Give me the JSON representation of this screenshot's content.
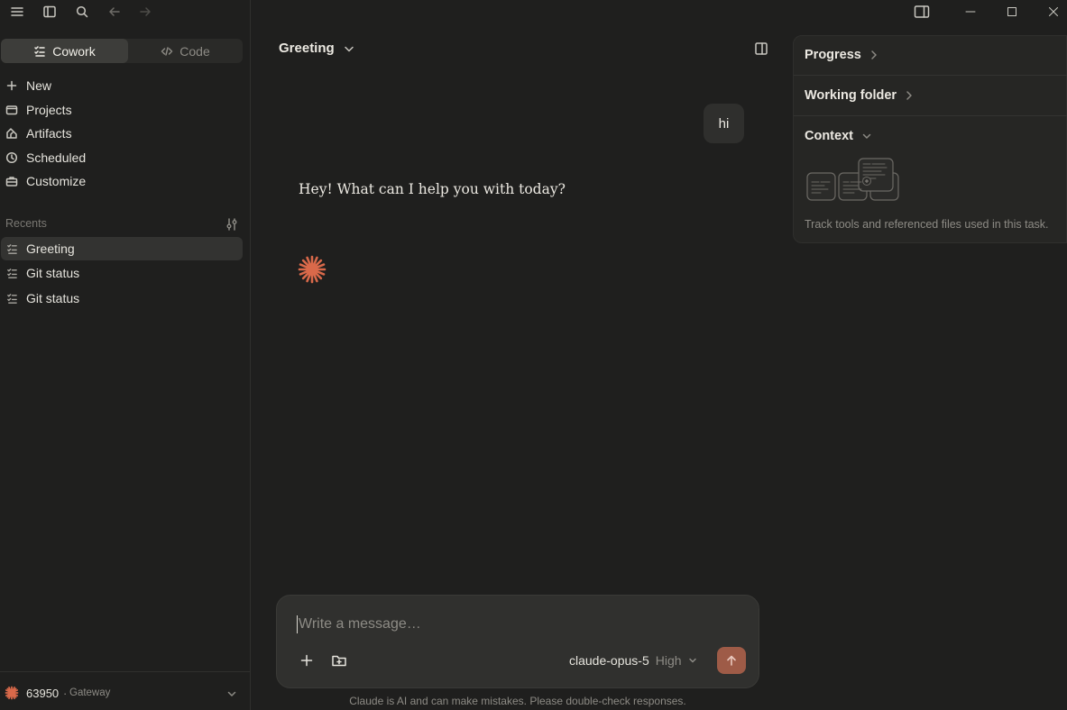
{
  "sidebar": {
    "modes": [
      {
        "label": "Cowork",
        "active": true
      },
      {
        "label": "Code",
        "active": false
      }
    ],
    "nav": [
      {
        "label": "New",
        "icon": "plus-icon"
      },
      {
        "label": "Projects",
        "icon": "folder-icon"
      },
      {
        "label": "Artifacts",
        "icon": "artifacts-icon"
      },
      {
        "label": "Scheduled",
        "icon": "clock-icon"
      },
      {
        "label": "Customize",
        "icon": "briefcase-icon"
      }
    ],
    "recents_label": "Recents",
    "recents": [
      {
        "label": "Greeting",
        "active": true
      },
      {
        "label": "Git status",
        "active": false
      },
      {
        "label": "Git status",
        "active": false
      }
    ],
    "footer": {
      "account": "63950",
      "separator": "·",
      "gateway": "Gateway"
    }
  },
  "main": {
    "chat_title": "Greeting",
    "user_message": "hi",
    "assistant_message": "Hey! What can I help you with today?",
    "composer": {
      "placeholder": "Write a message…",
      "model": "claude-opus-5",
      "effort": "High"
    },
    "disclaimer": "Claude is AI and can make mistakes. Please double-check responses."
  },
  "panel": {
    "progress": "Progress",
    "working_folder": "Working folder",
    "context": "Context",
    "context_desc": "Track tools and referenced files used in this task."
  },
  "colors": {
    "background": "#1f1f1e",
    "accent": "#d9694a",
    "send_button": "#9e5b47"
  }
}
